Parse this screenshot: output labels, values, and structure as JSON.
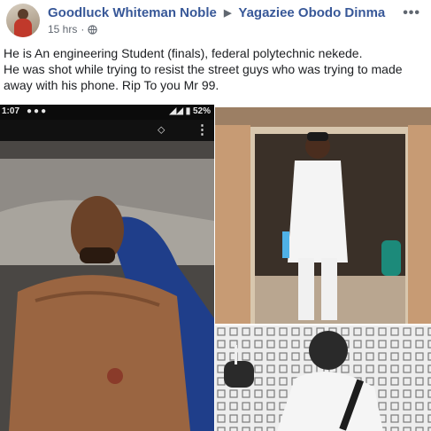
{
  "post": {
    "author": "Goodluck Whiteman Noble",
    "target": "Yagaziee Obodo Dinma",
    "time": "15 hrs",
    "privacy_icon": "globe-icon",
    "more_label": "•••",
    "text_line1": "He is An engineering Student (finals), federal polytechnic nekede.",
    "text_line2": "He was shot while trying to resist the street guys who was trying to made away with his phone. Rip To you Mr 99."
  },
  "phone_screen": {
    "time": "1:07",
    "status_dots": "●●●",
    "battery": "52%"
  },
  "colors": {
    "link": "#385898",
    "meta": "#606770",
    "text": "#1c1e21"
  }
}
